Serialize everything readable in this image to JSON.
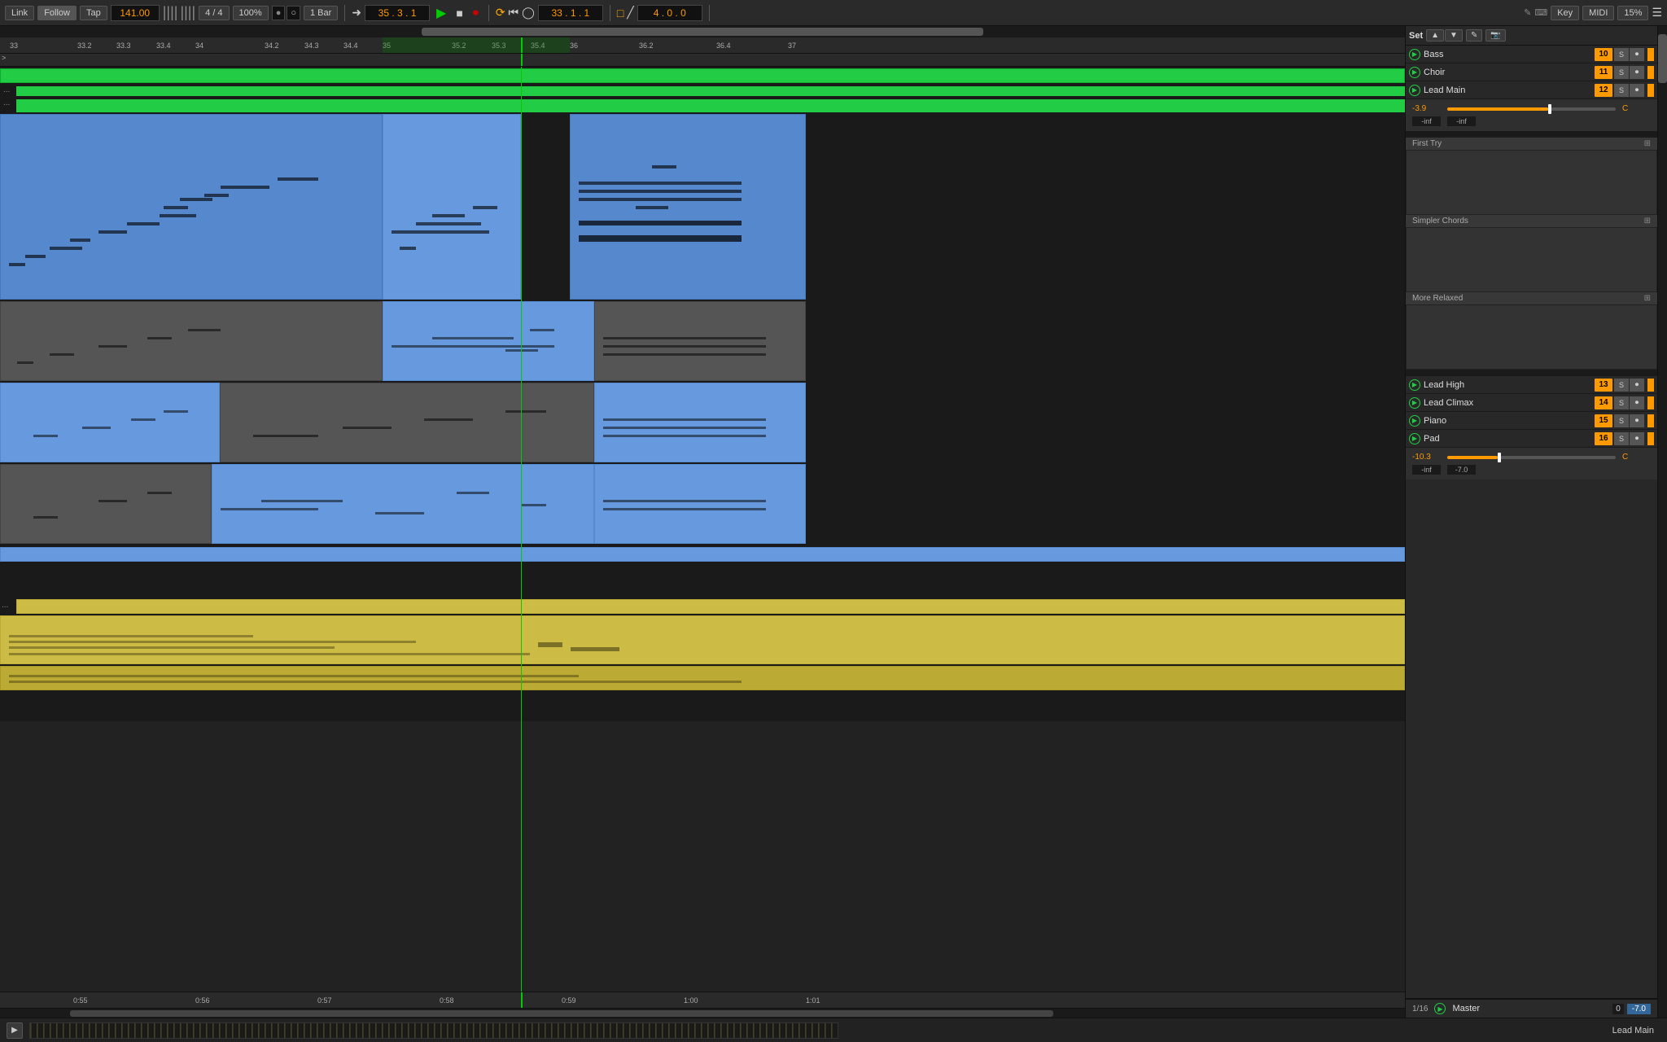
{
  "toolbar": {
    "link_label": "Link",
    "follow_label": "Follow",
    "tap_label": "Tap",
    "bpm": "141.00",
    "time_sig": "4 / 4",
    "zoom": "100%",
    "quantize": "1 Bar",
    "position1": "35 . 3 . 1",
    "transport_play": "▶",
    "transport_stop": "■",
    "position2": "33 . 1 . 1",
    "position3": "4 . 0 . 0",
    "key_label": "Key",
    "midi_label": "MIDI",
    "scale_pct": "15%"
  },
  "ruler": {
    "markers": [
      "33",
      "33.2",
      "33.3",
      "33.4",
      "34",
      "34.2",
      "34.3",
      "34.4",
      "35",
      "35.2",
      "35.3",
      "35.4",
      "36",
      "36.2",
      "36.4",
      "37"
    ]
  },
  "timeline": {
    "markers": [
      "0:55",
      "0:56",
      "0:57",
      "0:58",
      "0:59",
      "1:00",
      "1:01"
    ]
  },
  "mixer": {
    "set_label": "Set",
    "tracks": [
      {
        "name": "Bass",
        "num": "10",
        "color": "orange",
        "active": true
      },
      {
        "name": "Choir",
        "num": "11",
        "color": "orange",
        "active": true
      },
      {
        "name": "Lead Main",
        "num": "12",
        "color": "orange",
        "active": true
      },
      {
        "name": "First Try",
        "num": "",
        "color": "gray",
        "active": false
      },
      {
        "name": "Simpler Chords",
        "num": "",
        "color": "gray",
        "active": false
      },
      {
        "name": "More Relaxed",
        "num": "",
        "color": "gray",
        "active": false
      },
      {
        "name": "Lead High",
        "num": "13",
        "color": "orange",
        "active": true
      },
      {
        "name": "Lead Climax",
        "num": "14",
        "color": "orange",
        "active": true
      },
      {
        "name": "Piano",
        "num": "15",
        "color": "orange",
        "active": true
      },
      {
        "name": "Pad",
        "num": "16",
        "color": "orange",
        "active": true
      },
      {
        "name": "Master",
        "num": "",
        "color": "none",
        "active": true
      }
    ],
    "lead_main_fader": "-3.9",
    "lead_main_key": "C",
    "lead_main_db1": "-inf",
    "lead_main_db2": "-inf",
    "pad_fader": "-10.3",
    "pad_key": "C",
    "pad_db1": "-inf",
    "pad_db2": "-7.0",
    "master_val1": "0",
    "master_val2": "-7.0"
  },
  "bottom": {
    "page_label": "1/16",
    "clip_name": "Lead Main"
  },
  "colors": {
    "green_clip": "#22cc44",
    "blue_clip": "#5588cc",
    "gray_clip": "#666",
    "yellow_clip": "#ccbb44",
    "orange": "#ff9900"
  }
}
